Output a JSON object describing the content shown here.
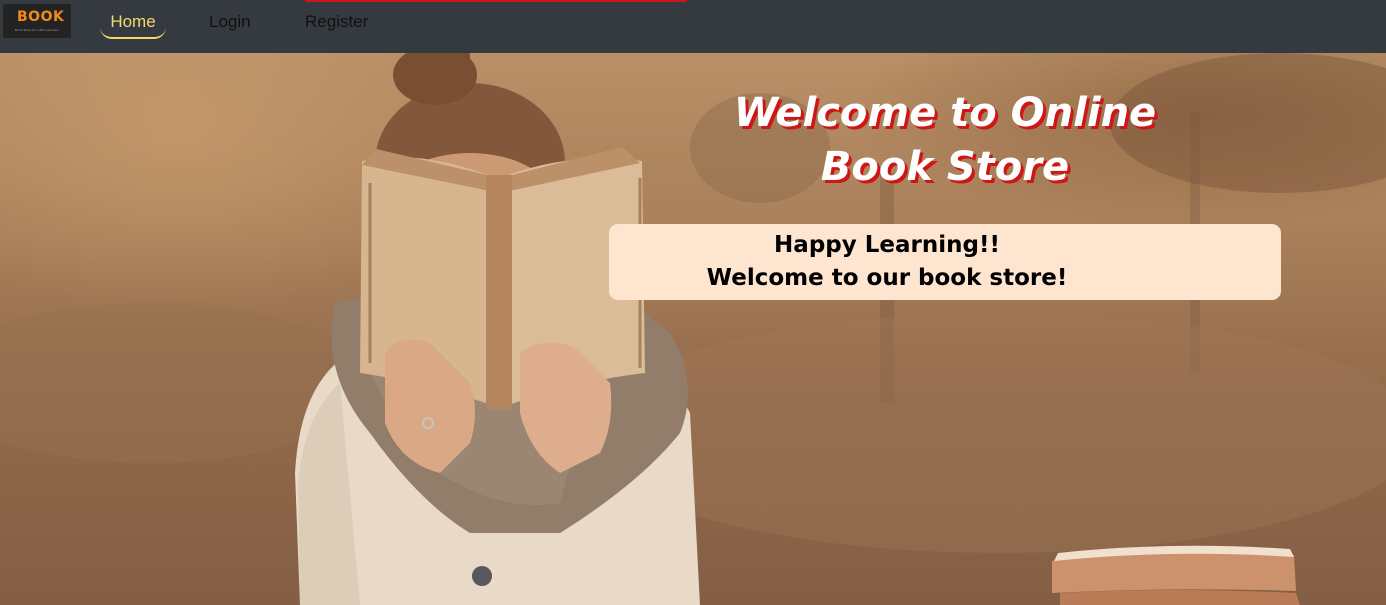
{
  "navbar": {
    "logo": {
      "text": "BOOK",
      "tagline": "Book Store for Little Learners"
    },
    "links": [
      {
        "label": "Home",
        "active": true
      },
      {
        "label": "Login"
      },
      {
        "label": "Register"
      }
    ]
  },
  "hero": {
    "title_line1": "Welcome to Online",
    "title_line2": "Book Store",
    "message_line1": "Happy Learning!!",
    "message_line2": "Welcome to our book store!"
  },
  "colors": {
    "navbar_bg": "#343a40",
    "active_link": "#f3d96a",
    "title_shadow": "#cf1515",
    "message_box_bg": "#fde5cf",
    "accent_line": "#d0141c"
  }
}
